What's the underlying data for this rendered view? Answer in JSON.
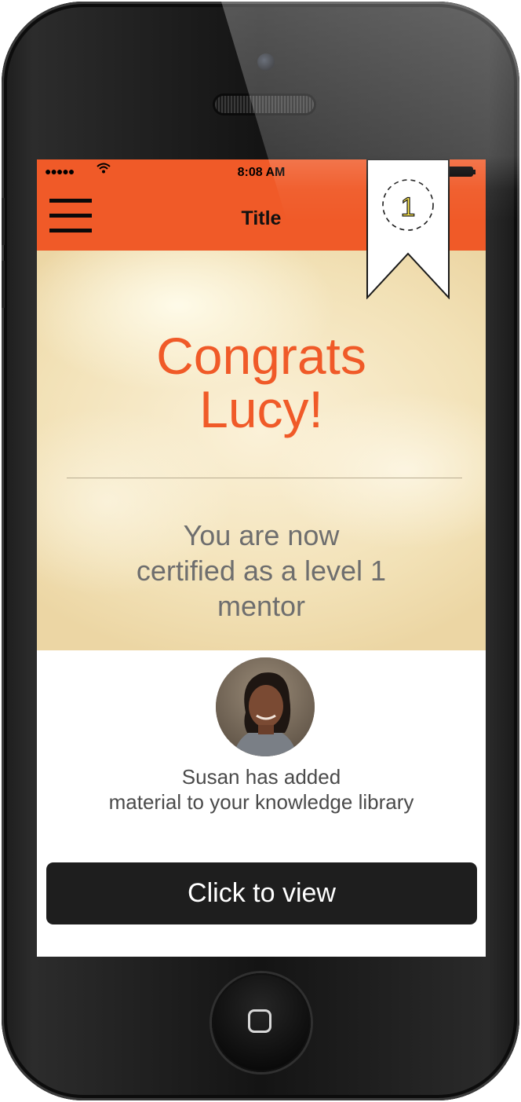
{
  "status_bar": {
    "signal": "●●●●●",
    "wifi_icon": "wifi-icon",
    "time": "8:08 AM",
    "battery_icon": "battery-icon"
  },
  "header": {
    "menu_icon": "hamburger-menu-icon",
    "title": "Title",
    "badge": {
      "icon": "ribbon-badge-icon",
      "level": "1"
    }
  },
  "hero": {
    "congrats_line1": "Congrats",
    "congrats_line2": "Lucy!",
    "message_line1": "You are now",
    "message_line2": "certified as a level 1",
    "message_line3": "mentor"
  },
  "notification": {
    "avatar_icon": "user-avatar",
    "line1": "Susan has added",
    "line2": "material to your knowledge library"
  },
  "cta": {
    "label": "Click to view"
  },
  "colors": {
    "accent": "#f05a28",
    "button_bg": "#1e1e1e",
    "hero_bg": "#f2e1b6",
    "badge_number": "#ffeb3b"
  }
}
